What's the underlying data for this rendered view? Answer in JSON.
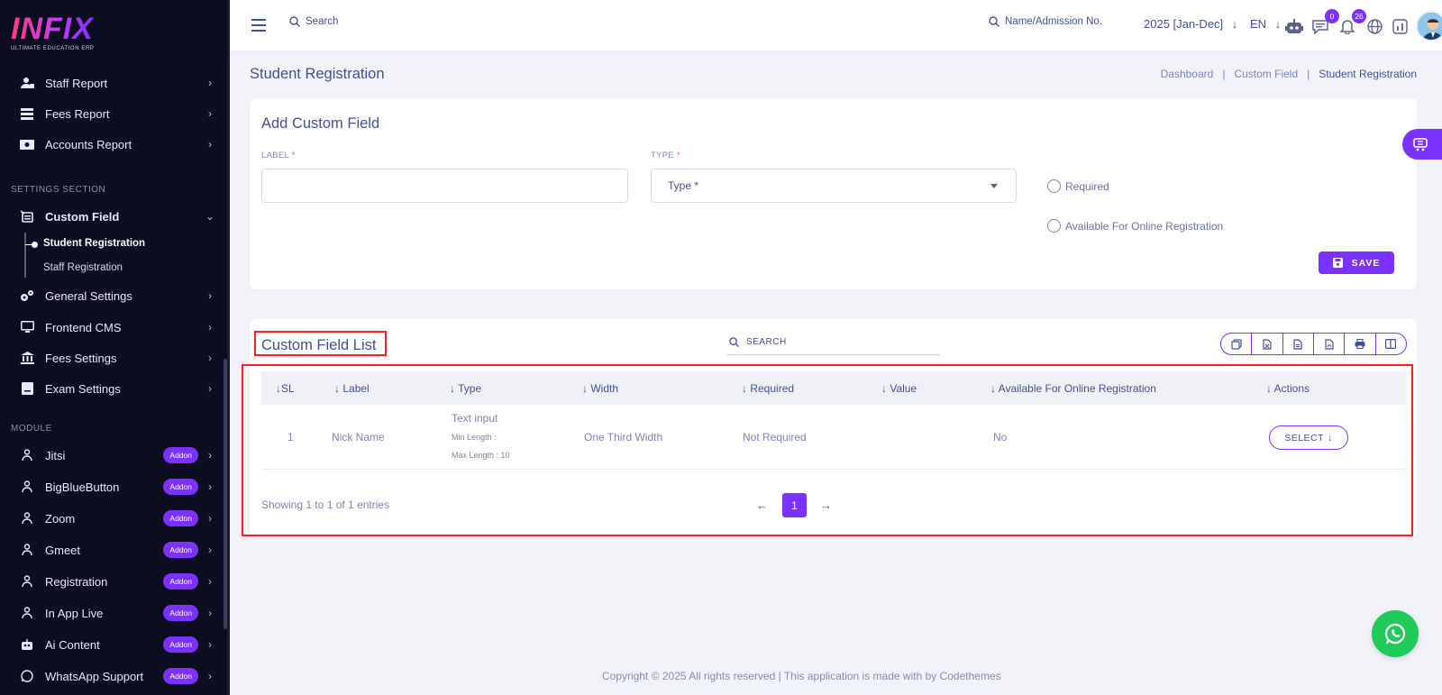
{
  "brand": {
    "name": "INFIX",
    "tagline": "ULTIMATE EDUCATION ERP"
  },
  "sidebar": {
    "reports": [
      {
        "label": "Staff Report",
        "icon": "staff-report-icon"
      },
      {
        "label": "Fees Report",
        "icon": "fees-report-icon"
      },
      {
        "label": "Accounts Report",
        "icon": "accounts-report-icon"
      }
    ],
    "settings_title": "SETTINGS SECTION",
    "custom_field": {
      "label": "Custom Field",
      "expanded": true
    },
    "sub_items": [
      {
        "label": "Student Registration",
        "active": true
      },
      {
        "label": "Staff Registration",
        "active": false
      }
    ],
    "settings": [
      {
        "label": "General Settings"
      },
      {
        "label": "Frontend CMS"
      },
      {
        "label": "Fees Settings"
      },
      {
        "label": "Exam Settings"
      }
    ],
    "module_title": "MODULE",
    "modules": [
      {
        "label": "Jitsi",
        "badge": "Addon"
      },
      {
        "label": "BigBlueButton",
        "badge": "Addon"
      },
      {
        "label": "Zoom",
        "badge": "Addon"
      },
      {
        "label": "Gmeet",
        "badge": "Addon"
      },
      {
        "label": "Registration",
        "badge": "Addon"
      },
      {
        "label": "In App Live",
        "badge": "Addon"
      },
      {
        "label": "Ai Content",
        "badge": "Addon"
      },
      {
        "label": "WhatsApp Support",
        "badge": "Addon"
      }
    ]
  },
  "header": {
    "search_placeholder": "Search",
    "name_search_placeholder": "Name/Admission No.",
    "academic_year": "2025 [Jan-Dec]",
    "language": "EN",
    "message_count": "0",
    "notification_count": "26"
  },
  "page": {
    "title": "Student Registration",
    "breadcrumb": [
      "Dashboard",
      "Custom Field",
      "Student Registration"
    ]
  },
  "form": {
    "title": "Add Custom Field",
    "label_field": {
      "label": "LABEL",
      "required_mark": "*",
      "value": ""
    },
    "type_field": {
      "label": "TYPE",
      "required_mark": "*",
      "selected": "Type *"
    },
    "required_option": "Required",
    "online_option": "Available For Online Registration",
    "save_label": "SAVE"
  },
  "list": {
    "title": "Custom Field List",
    "search_placeholder": "SEARCH",
    "export_buttons": [
      "copy-icon",
      "excel-icon",
      "csv-icon",
      "pdf-icon",
      "print-icon",
      "columns-icon"
    ],
    "columns": [
      "SL",
      "Label",
      "Type",
      "Width",
      "Required",
      "Value",
      "Available For Online Registration",
      "Actions"
    ],
    "rows": [
      {
        "sl": "1",
        "label": "Nick Name",
        "type": "Text input",
        "min_length": "Min Length :",
        "max_length": "Max Length : 10",
        "width": "One Third Width",
        "required": "Not Required",
        "value": "",
        "online": "No",
        "action": "SELECT"
      }
    ],
    "showing": "Showing 1 to 1 of 1 entries",
    "current_page": "1"
  },
  "footer": {
    "text": "Copyright © 2025 All rights reserved | This application is made with by Codethemes"
  },
  "colors": {
    "accent": "#7c32ff",
    "text": "#415094",
    "sidebar": "#0c0d20",
    "highlight": "#ff1f1f",
    "whatsapp": "#1fc95a"
  }
}
